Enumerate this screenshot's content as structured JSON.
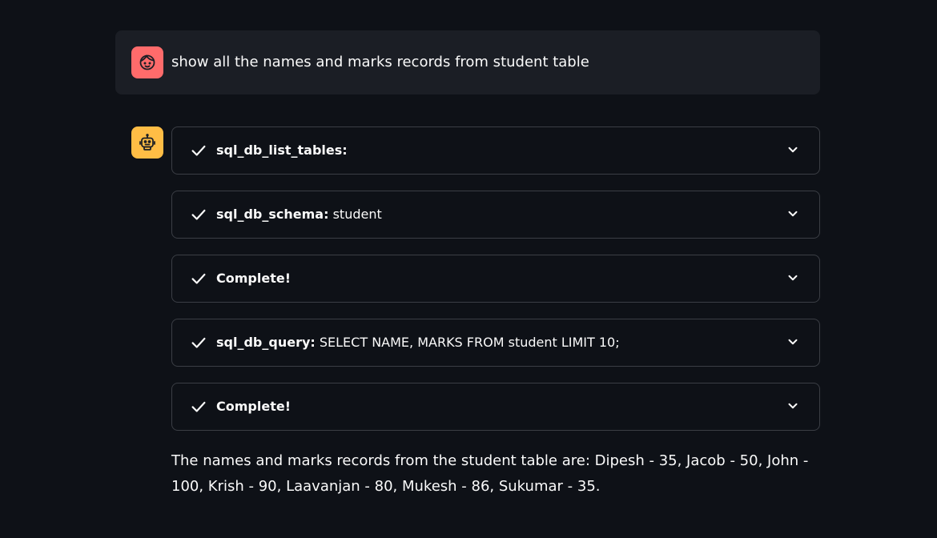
{
  "user_message": {
    "avatar_icon": "face-icon",
    "avatar_color": "#ff6b6b",
    "text": "show all the names and marks records from student table"
  },
  "assistant_message": {
    "avatar_icon": "robot-icon",
    "avatar_color": "#ffbd45",
    "steps": [
      {
        "status_icon": "check-icon",
        "tool": "sql_db_list_tables:",
        "detail": ""
      },
      {
        "status_icon": "check-icon",
        "tool": "sql_db_schema:",
        "detail": "student"
      },
      {
        "status_icon": "check-icon",
        "tool": "Complete!",
        "detail": ""
      },
      {
        "status_icon": "check-icon",
        "tool": "sql_db_query:",
        "detail": "SELECT NAME, MARKS FROM student LIMIT 10;"
      },
      {
        "status_icon": "check-icon",
        "tool": "Complete!",
        "detail": ""
      }
    ],
    "answer": "The names and marks records from the student table are: Dipesh - 35, Jacob - 50, John - 100, Krish - 90, Laavanjan - 80, Mukesh - 86, Sukumar - 35."
  },
  "colors": {
    "background": "#0e1117",
    "user_bubble": "#1b1e25",
    "expander_border": "#3b3e45",
    "text": "#fafafa"
  }
}
